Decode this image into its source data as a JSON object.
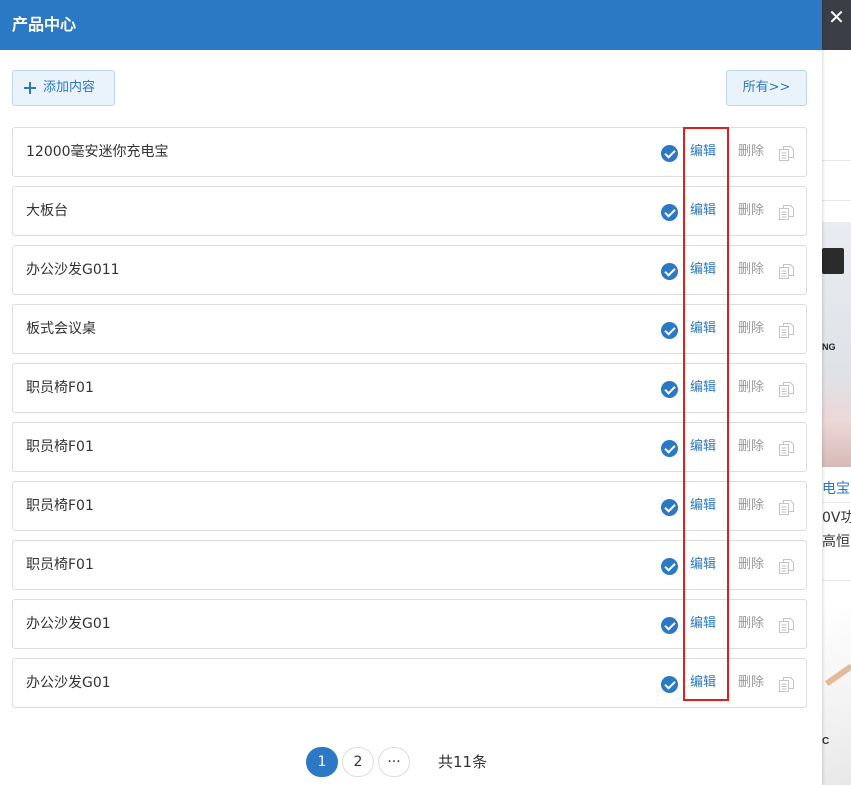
{
  "dialog": {
    "title": "产品中心",
    "add_button": "添加内容",
    "all_button": "所有>>",
    "close_symbol": "✕"
  },
  "rows": [
    {
      "title": "12000毫安迷你充电宝",
      "edit": "编辑",
      "delete": "删除"
    },
    {
      "title": "大板台",
      "edit": "编辑",
      "delete": "删除"
    },
    {
      "title": "办公沙发G011",
      "edit": "编辑",
      "delete": "删除"
    },
    {
      "title": "板式会议桌",
      "edit": "编辑",
      "delete": "删除"
    },
    {
      "title": "职员椅F01",
      "edit": "编辑",
      "delete": "删除"
    },
    {
      "title": "职员椅F01",
      "edit": "编辑",
      "delete": "删除"
    },
    {
      "title": "职员椅F01",
      "edit": "编辑",
      "delete": "删除"
    },
    {
      "title": "职员椅F01",
      "edit": "编辑",
      "delete": "删除"
    },
    {
      "title": "办公沙发G01",
      "edit": "编辑",
      "delete": "删除"
    },
    {
      "title": "办公沙发G01",
      "edit": "编辑",
      "delete": "删除"
    }
  ],
  "pagination": {
    "pages": [
      "1",
      "2",
      "···"
    ],
    "current": "1",
    "total": "共11条"
  },
  "background": {
    "brand_fragment": "NG",
    "product_title_fragment": "电宝",
    "desc_line1": "0V功",
    "desc_line2": "高恒",
    "box_label": "C"
  },
  "colors": {
    "primary": "#2b78c5",
    "highlight": "#e02020",
    "muted": "#999999"
  }
}
